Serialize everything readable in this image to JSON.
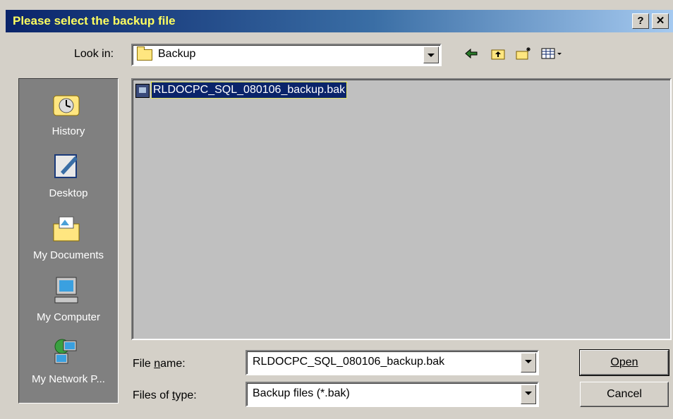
{
  "dialog": {
    "title": "Please select the backup file",
    "help_button": "?",
    "close_button": "✕"
  },
  "lookin": {
    "label": "Look in:",
    "value": "Backup"
  },
  "toolbar": {
    "back_icon": "back-arrow-icon",
    "up_icon": "up-folder-icon",
    "new_folder_icon": "new-folder-icon",
    "view_menu_icon": "view-menu-icon"
  },
  "places": [
    {
      "label": "History",
      "icon": "history-icon"
    },
    {
      "label": "Desktop",
      "icon": "desktop-icon"
    },
    {
      "label": "My Documents",
      "icon": "my-documents-icon"
    },
    {
      "label": "My Computer",
      "icon": "my-computer-icon"
    },
    {
      "label": "My Network P...",
      "icon": "my-network-places-icon"
    }
  ],
  "files": [
    {
      "name": "RLDOCPC_SQL_080106_backup.bak",
      "selected": true
    }
  ],
  "filename": {
    "label": "File name:",
    "value": "RLDOCPC_SQL_080106_backup.bak"
  },
  "filetype": {
    "label": "Files of type:",
    "value": "Backup files (*.bak)"
  },
  "buttons": {
    "open": "Open",
    "cancel": "Cancel"
  }
}
